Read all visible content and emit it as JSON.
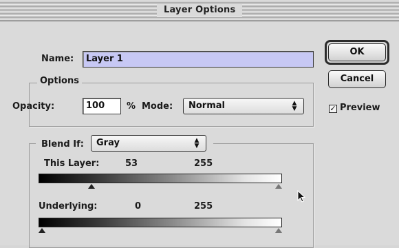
{
  "window": {
    "title": "Layer Options"
  },
  "name": {
    "label": "Name:",
    "value": "Layer 1"
  },
  "options": {
    "group_label": "Options",
    "opacity_label": "Opacity:",
    "opacity_value": "100",
    "opacity_unit": "%",
    "mode_label": "Mode:",
    "mode_value": "Normal"
  },
  "buttons": {
    "ok": "OK",
    "cancel": "Cancel"
  },
  "preview": {
    "label": "Preview",
    "checked": true
  },
  "blend_if": {
    "label": "Blend If:",
    "channel": "Gray",
    "this_layer": {
      "label": "This Layer:",
      "black_value": "53",
      "white_value": "255",
      "black_fraction": 0.208,
      "white_fraction": 1.0
    },
    "underlying": {
      "label": "Underlying:",
      "black_value": "0",
      "white_value": "255",
      "black_fraction": 0.0,
      "white_fraction": 1.0
    }
  },
  "colors": {
    "name_field_highlight": "#c7c8f4",
    "window_bg": "#dadada"
  }
}
